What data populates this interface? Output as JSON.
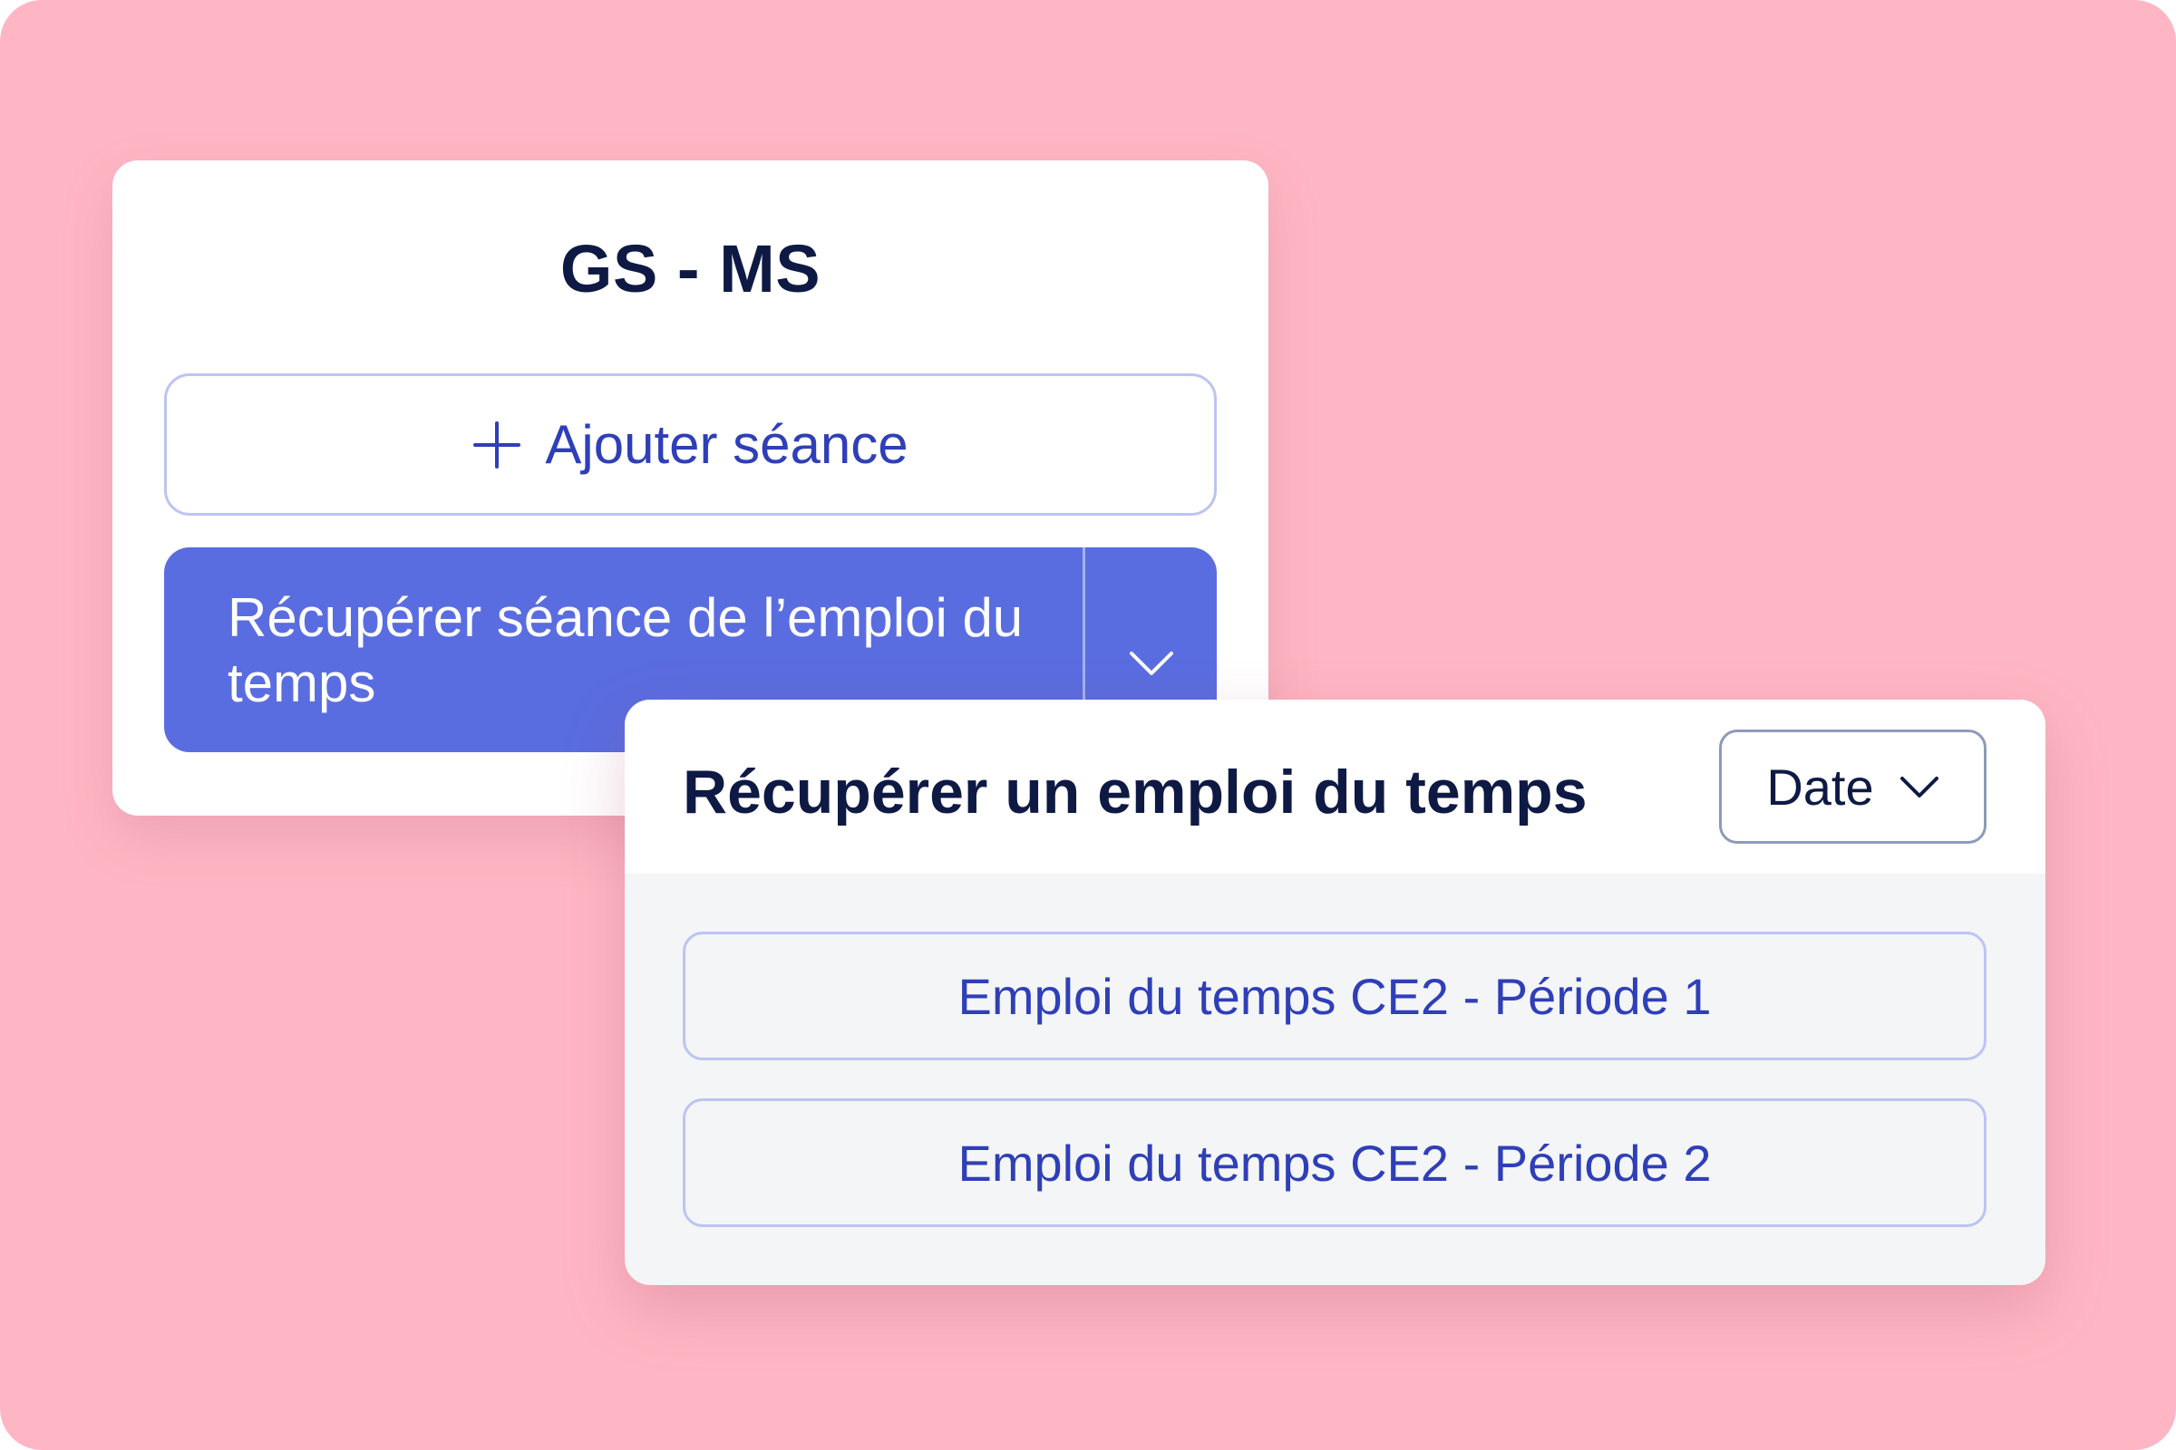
{
  "session_card": {
    "title": "GS - MS",
    "add_button_label": "Ajouter séance",
    "retrieve_button_label": "Récupérer séance de l’emploi du temps"
  },
  "schedule_panel": {
    "title": "Récupérer un emploi du temps",
    "sort_label": "Date",
    "items": [
      {
        "label": "Emploi du temps CE2 - Période 1"
      },
      {
        "label": "Emploi du temps CE2 - Période 2"
      }
    ]
  },
  "icons": {
    "add": "plus-icon",
    "dropdown": "chevron-down-icon",
    "sort": "chevron-down-icon"
  },
  "colors": {
    "background": "#FFB6C4",
    "card": "#FFFFFF",
    "panel_body": "#F4F5F7",
    "primary": "#5A6DE0",
    "primary_text": "#2F3FB8",
    "title_text": "#0E1A44",
    "outline": "#BCC4F1"
  }
}
